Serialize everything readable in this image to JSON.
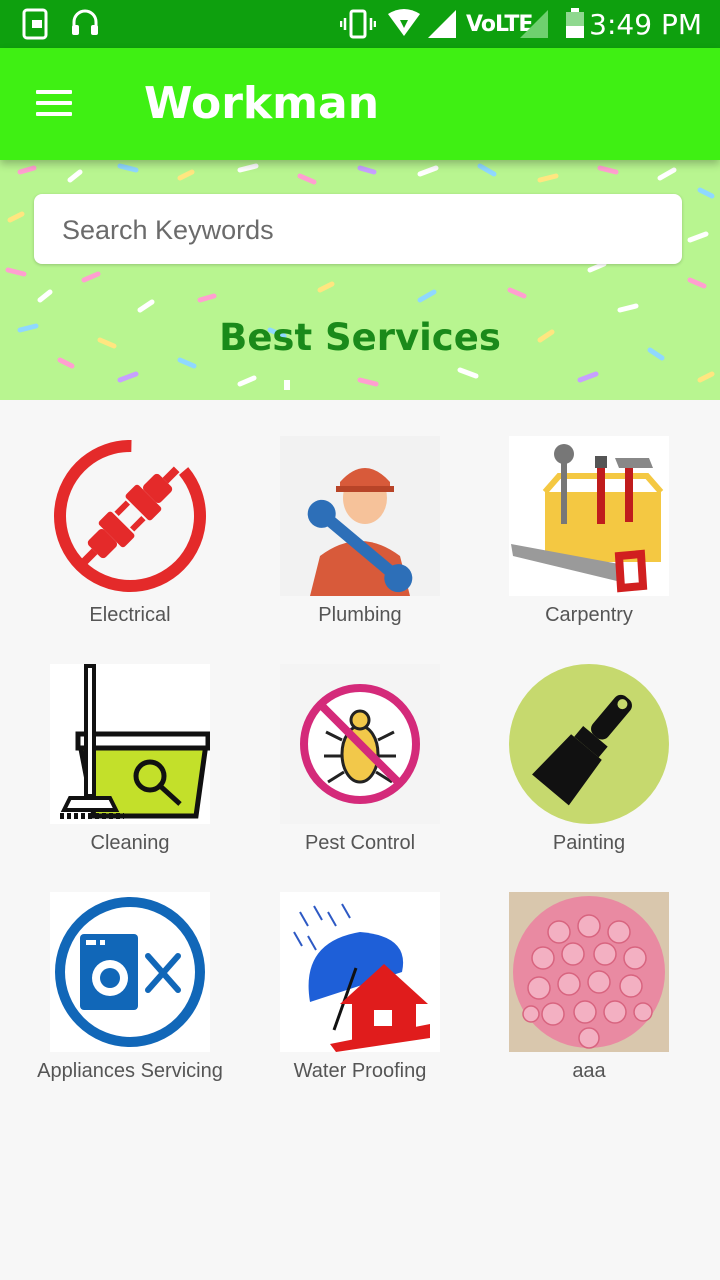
{
  "status_bar": {
    "time": "3:49 PM",
    "network": "VoLTE"
  },
  "app_bar": {
    "title": "Workman"
  },
  "search": {
    "placeholder": "Search Keywords"
  },
  "banner": {
    "heading": "Best Services"
  },
  "services": [
    {
      "label": "Electrical",
      "icon": "electric-plug-icon"
    },
    {
      "label": "Plumbing",
      "icon": "plumber-wrench-icon"
    },
    {
      "label": "Carpentry",
      "icon": "toolbox-icon"
    },
    {
      "label": "Cleaning",
      "icon": "mop-bucket-icon"
    },
    {
      "label": "Pest Control",
      "icon": "no-bug-icon"
    },
    {
      "label": "Painting",
      "icon": "paint-brush-icon"
    },
    {
      "label": "Appliances Servicing",
      "icon": "washing-machine-icon"
    },
    {
      "label": "Water Proofing",
      "icon": "umbrella-house-icon"
    },
    {
      "label": "aaa",
      "icon": "roses-photo"
    }
  ],
  "colors": {
    "status_bar": "#0ea00e",
    "app_bar": "#3ff013",
    "banner": "#b8f590",
    "heading": "#1a8a1a"
  }
}
